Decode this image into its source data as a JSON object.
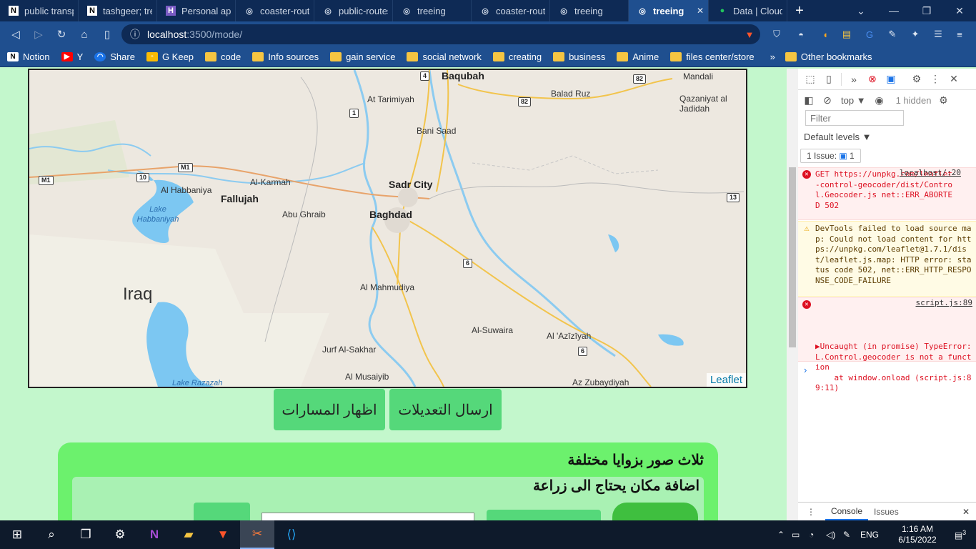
{
  "browser": {
    "tabs": [
      {
        "title": "public transpo",
        "icon": "notion-icon"
      },
      {
        "title": "tashgeer; tree",
        "icon": "notion-icon"
      },
      {
        "title": "Personal apps",
        "icon": "heroku-icon"
      },
      {
        "title": "coaster-route",
        "icon": "globe-icon"
      },
      {
        "title": "public-routes;",
        "icon": "globe-icon"
      },
      {
        "title": "treeing",
        "icon": "globe-icon"
      },
      {
        "title": "coaster-route",
        "icon": "globe-icon"
      },
      {
        "title": "treeing",
        "icon": "globe-icon"
      },
      {
        "title": "treeing",
        "icon": "globe-icon",
        "active": true
      },
      {
        "title": "Data | Cloud",
        "icon": "leaf-icon"
      }
    ],
    "url_host": "localhost",
    "url_path": ":3500/mode/",
    "bookmarks": [
      {
        "label": "Notion",
        "icon": "notion-icon"
      },
      {
        "label": "Y",
        "icon": "youtube-icon"
      },
      {
        "label": "Share",
        "icon": "share-icon"
      },
      {
        "label": "G Keep",
        "icon": "keep-icon"
      },
      {
        "label": "code",
        "icon": "folder-icon"
      },
      {
        "label": "Info sources",
        "icon": "folder-icon"
      },
      {
        "label": "gain service",
        "icon": "folder-icon"
      },
      {
        "label": "social network",
        "icon": "folder-icon"
      },
      {
        "label": "creating",
        "icon": "folder-icon"
      },
      {
        "label": "business",
        "icon": "folder-icon"
      },
      {
        "label": "Anime",
        "icon": "folder-icon"
      },
      {
        "label": "files center/store",
        "icon": "folder-icon"
      }
    ],
    "other_bookmarks": "Other bookmarks"
  },
  "map": {
    "country": "Iraq",
    "cities": [
      "Baqubah",
      "Sadr City",
      "Baghdad",
      "Fallujah"
    ],
    "towns": [
      "At Tarimiyah",
      "Balad Ruz",
      "Mandali",
      "Qazaniyat al Jadidah",
      "Bani Saad",
      "Al-Karmah",
      "Al Habbaniya",
      "Abu Ghraib",
      "Al Mahmudiya",
      "Al-Suwaira",
      "Al 'Azīzīyah",
      "Jurf Al-Sakhar",
      "Al Musaiyib",
      "Az Zubaydiyah"
    ],
    "lakes": [
      "Lake Habbaniyah",
      "Lake Razazah"
    ],
    "shields": [
      "4",
      "82",
      "82",
      "1",
      "M1",
      "10",
      "M1",
      "13",
      "6",
      "6"
    ],
    "attribution": "Leaflet"
  },
  "buttons": {
    "show_routes": "اظهار المسارات",
    "send_edits": "ارسال التعديلات"
  },
  "panel": {
    "title": "ثلاث صور بزوايا مختلفة",
    "subtitle": "اضافة مكان يحتاج الى زراعة"
  },
  "devtools": {
    "context": "top",
    "hidden": "1 hidden",
    "filter_placeholder": "Filter",
    "levels": "Default levels ▼",
    "issues_badge": "1 Issue: ",
    "issues_count": "1",
    "messages": [
      {
        "type": "error",
        "text": "GET https://unpkg.com/leaflet-control-geocoder/dist/Control.Geocoder.js net::ERR_ABORTED 502",
        "source": "localhost/:20"
      },
      {
        "type": "warning",
        "text": "DevTools failed to load source map: Could not load content for https://unpkg.com/leaflet@1.7.1/dist/leaflet.js.map: HTTP error: status code 502, net::ERR_HTTP_RESPONSE_CODE_FAILURE"
      },
      {
        "type": "error",
        "text": "▶Uncaught (in promise) TypeError: L.Control.geocoder is not a function\n    at window.onload (script.js:89:11)",
        "source": "script.js:89"
      }
    ],
    "drawer_tabs": [
      "Console",
      "Issues"
    ]
  },
  "taskbar": {
    "time": "1:16 AM",
    "date": "6/15/2022",
    "lang": "ENG",
    "notifications": "3"
  }
}
